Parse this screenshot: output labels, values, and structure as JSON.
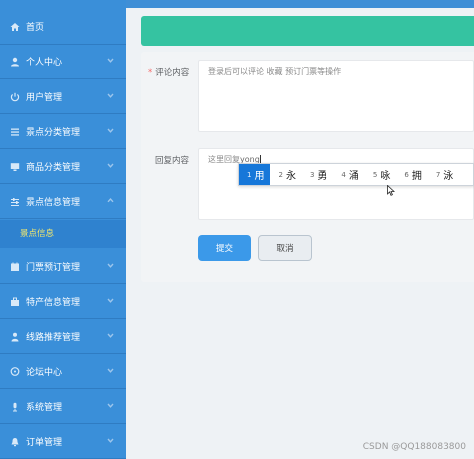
{
  "sidebar": {
    "items": [
      {
        "label": "首页",
        "icon": "home-icon"
      },
      {
        "label": "个人中心",
        "icon": "user-icon"
      },
      {
        "label": "用户管理",
        "icon": "power-icon"
      },
      {
        "label": "景点分类管理",
        "icon": "list-icon"
      },
      {
        "label": "商品分类管理",
        "icon": "monitor-icon"
      },
      {
        "label": "景点信息管理",
        "icon": "sliders-icon"
      },
      {
        "label": "门票预订管理",
        "icon": "ticket-icon"
      },
      {
        "label": "特产信息管理",
        "icon": "briefcase-icon"
      },
      {
        "label": "线路推荐管理",
        "icon": "person-icon"
      },
      {
        "label": "论坛中心",
        "icon": "chat-icon"
      },
      {
        "label": "系统管理",
        "icon": "mic-icon"
      },
      {
        "label": "订单管理",
        "icon": "bell-icon"
      }
    ],
    "sub_item": "景点信息"
  },
  "form": {
    "comment_label": "评论内容",
    "comment_required_mark": "*",
    "comment_placeholder": "登录后可以评论  收藏   预订门票等操作",
    "reply_label": "回复内容",
    "reply_prefix": "这里回复",
    "reply_composing": "yong",
    "submit_label": "提交",
    "cancel_label": "取消"
  },
  "ime": {
    "candidates": [
      {
        "num": "1",
        "text": "用"
      },
      {
        "num": "2",
        "text": "永"
      },
      {
        "num": "3",
        "text": "勇"
      },
      {
        "num": "4",
        "text": "涌"
      },
      {
        "num": "5",
        "text": "咏"
      },
      {
        "num": "6",
        "text": "拥"
      },
      {
        "num": "7",
        "text": "泳"
      }
    ],
    "selected_index": 0
  },
  "watermark": "CSDN @QQ188083800",
  "colors": {
    "sidebar_bg": "#3a8fd9",
    "accent_green": "#35c3a1",
    "submit_blue": "#3b99e9",
    "active_sub_text": "#f5e96b"
  }
}
